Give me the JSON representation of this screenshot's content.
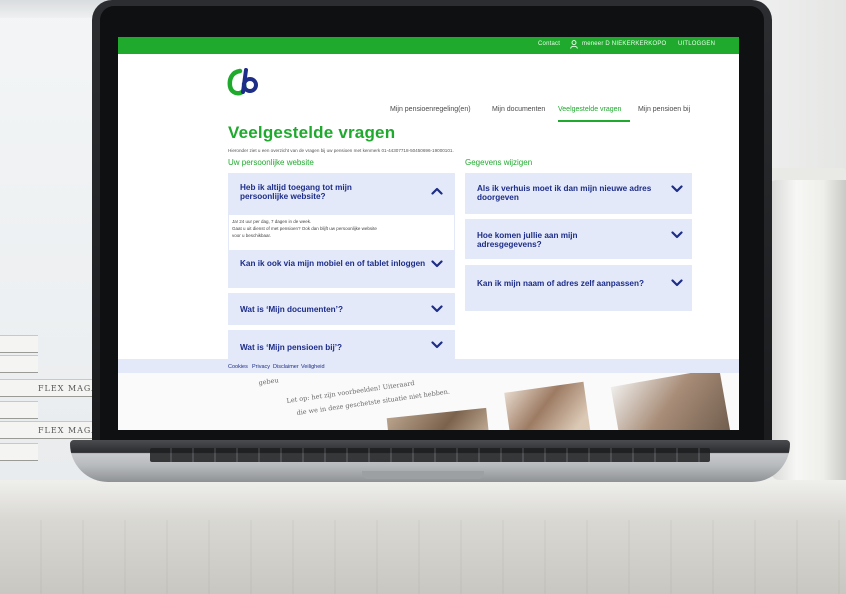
{
  "topbar": {
    "contact": "Contact",
    "user": "meneer D NIEKERKERKOPO",
    "logout": "UITLOGGEN"
  },
  "nav": {
    "items": [
      "Mijn pensioenregeling(en)",
      "Mijn documenten",
      "Veelgestelde vragen",
      "Mijn pensioen bij"
    ],
    "active_index": 2
  },
  "page": {
    "title": "Veelgestelde vragen",
    "intro": "Hieronder ziet u een overzicht van de vragen bij uw pensioen met kenmerk 01-44307718-50450696-19000101.",
    "left_heading": "Uw persoonlijke website",
    "right_heading": "Gegevens wijzigen"
  },
  "faq_left": [
    {
      "question": "Heb ik altijd toegang tot mijn persoonlijke website?",
      "expanded": true
    },
    {
      "question": "Kan ik ook via mijn mobiel en of tablet inloggen",
      "expanded": false
    },
    {
      "question": "Wat is ‘Mijn documenten’?",
      "expanded": false
    },
    {
      "question": "Wat is ‘Mijn pensioen bij’?",
      "expanded": false
    }
  ],
  "answer_lines": [
    "Ja! 24 uur per dag, 7 dagen in de week.",
    "Gaat u uit dienst of met pensioen? Ook dan blijft uw persoonlijke website",
    "voor u beschikbaar."
  ],
  "faq_right": [
    {
      "question": "Als ik verhuis moet ik dan mijn nieuwe adres doorgeven",
      "expanded": false
    },
    {
      "question": "Hoe komen jullie aan mijn adresgegevens?",
      "expanded": false
    },
    {
      "question": "Kan ik mijn naam of adres zelf aanpassen?",
      "expanded": false
    }
  ],
  "footer": {
    "links": [
      "Cookies",
      "Privacy",
      "Disclaimer",
      "Veiligheid"
    ]
  },
  "promo": {
    "line1": "gebeu",
    "line2": "Let op: het zijn voorbeelden! Uiteraard",
    "line3": "die we in deze geschetste situatie niet hebben."
  },
  "books": [
    "FLEX MAGA",
    "FLEX MAGAZ"
  ],
  "colors": {
    "brand_green": "#1faa2e",
    "brand_navy": "#1d2d88",
    "faq_bg": "#e3e9f8"
  }
}
